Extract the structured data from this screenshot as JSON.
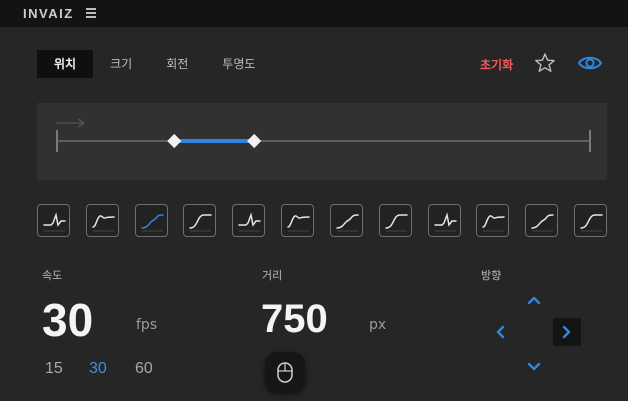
{
  "app": {
    "logo": "INVAIZ"
  },
  "tabs": [
    {
      "label": "위치",
      "active": true
    },
    {
      "label": "크기",
      "active": false
    },
    {
      "label": "회전",
      "active": false
    },
    {
      "label": "투명도",
      "active": false
    }
  ],
  "toolbar": {
    "reset_label": "초기화",
    "favorite_icon": "star-icon",
    "visibility_icon": "eye-icon"
  },
  "track": {
    "range_start": 0.22,
    "range_end": 0.37,
    "accent": "#2f86e0"
  },
  "easing_presets": {
    "count": 12,
    "selected_index": 2,
    "shapes": [
      "step-bump",
      "ease-out-bump",
      "ease-in-out",
      "s-curve",
      "step-bump",
      "ease-out-bump",
      "ease-in-out",
      "s-curve",
      "step-bump",
      "ease-out-bump",
      "ease-in-out",
      "s-curve"
    ]
  },
  "speed": {
    "label": "속도",
    "value": "30",
    "unit": "fps",
    "presets": [
      {
        "label": "15",
        "active": false
      },
      {
        "label": "30",
        "active": true
      },
      {
        "label": "60",
        "active": false
      }
    ]
  },
  "distance": {
    "label": "거리",
    "value": "750",
    "unit": "px",
    "mouse_icon": "mouse-icon"
  },
  "direction": {
    "label": "방향",
    "selected": "right",
    "accent": "#2f86e0"
  },
  "colors": {
    "accent": "#2f86e0",
    "reset": "#f25c5c",
    "background": "#262626",
    "topbar": "#131313"
  }
}
